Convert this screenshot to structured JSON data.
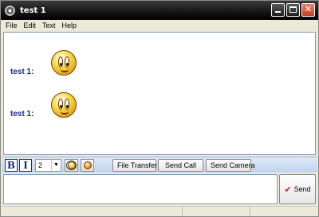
{
  "window": {
    "title": "test 1",
    "controls": {
      "minimize": "",
      "maximize": "",
      "close": "✕"
    }
  },
  "menu": [
    "File",
    "Edit",
    "Text",
    "Help"
  ],
  "chat": {
    "messages": [
      {
        "sender": "test 1:",
        "content_icon": "smiley-icon"
      },
      {
        "sender": "test 1:",
        "content_icon": "smiley-icon"
      }
    ]
  },
  "toolbar": {
    "bold_label": "B",
    "italic_label": "I",
    "font_size": "2",
    "file_transfer_label": "File Transfer",
    "send_call_label": "Send Call",
    "send_camera_label": "Send Camera"
  },
  "compose": {
    "value": "",
    "send_label": "Send",
    "send_icon": "✔"
  },
  "colors": {
    "sender": "#1a2c8c",
    "titlebar": "#141414",
    "close_button": "#c3401f",
    "toolbar": "#bfd3ee"
  }
}
